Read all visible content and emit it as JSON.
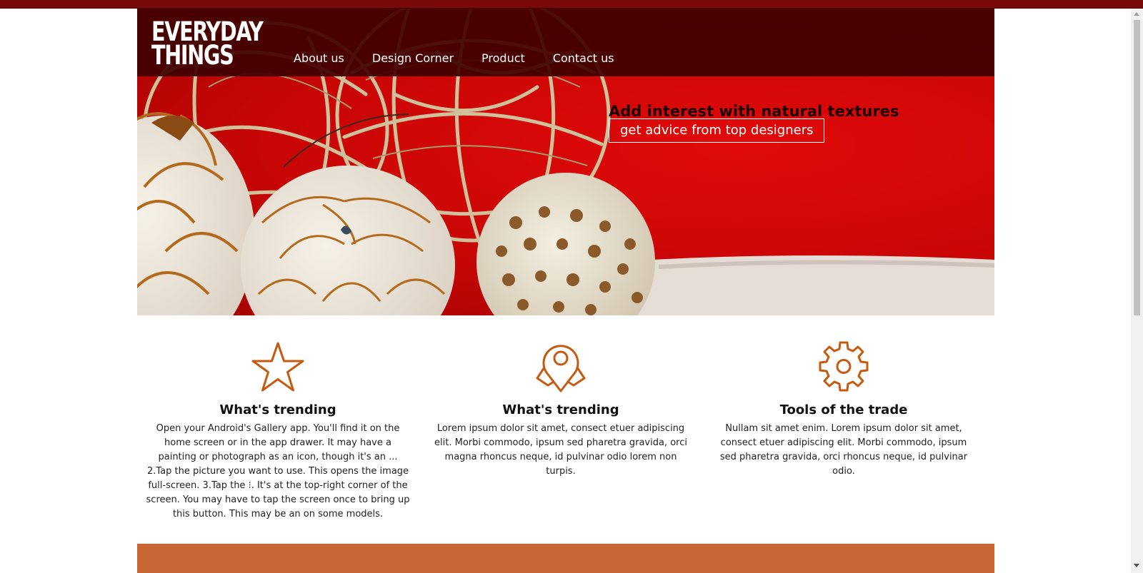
{
  "site": {
    "logo_line1": "EVERYDAY",
    "logo_line2": "THINGS"
  },
  "nav": {
    "items": [
      {
        "label": "About us"
      },
      {
        "label": "Design Corner"
      },
      {
        "label": "Product"
      },
      {
        "label": "Contact us"
      }
    ]
  },
  "hero": {
    "heading": "Add interest with natural textures",
    "button_label": "get advice from top designers"
  },
  "features": [
    {
      "icon": "star-icon",
      "title": "What's trending",
      "text": "Open your Android's Gallery app. You'll find it on the home screen or in the app drawer. It may have a painting or photograph as an icon, though it's an ... 2.Tap the picture you want to use. This opens the image full-screen. 3.Tap the ⁝. It's at the top-right corner of the screen. You may have to tap the screen once to bring up this button. This may be an on some models."
    },
    {
      "icon": "map-pin-icon",
      "title": "What's trending",
      "text": "Lorem ipsum dolor sit amet, consect etuer adipiscing elit. Morbi commodo, ipsum sed pharetra gravida, orci magna rhoncus neque, id pulvinar odio lorem non turpis."
    },
    {
      "icon": "gear-icon",
      "title": "Tools of the trade",
      "text": "Nullam sit amet enim. Lorem ipsum dolor sit amet, consect etuer adipiscing elit. Morbi commodo, ipsum sed pharetra gravida, orci rhoncus neque, id pulvinar odio."
    }
  ],
  "colors": {
    "nav_background": "#410000",
    "hero_red": "#c80606",
    "icon_accent": "#c55a11",
    "footer_band": "#c96635"
  }
}
